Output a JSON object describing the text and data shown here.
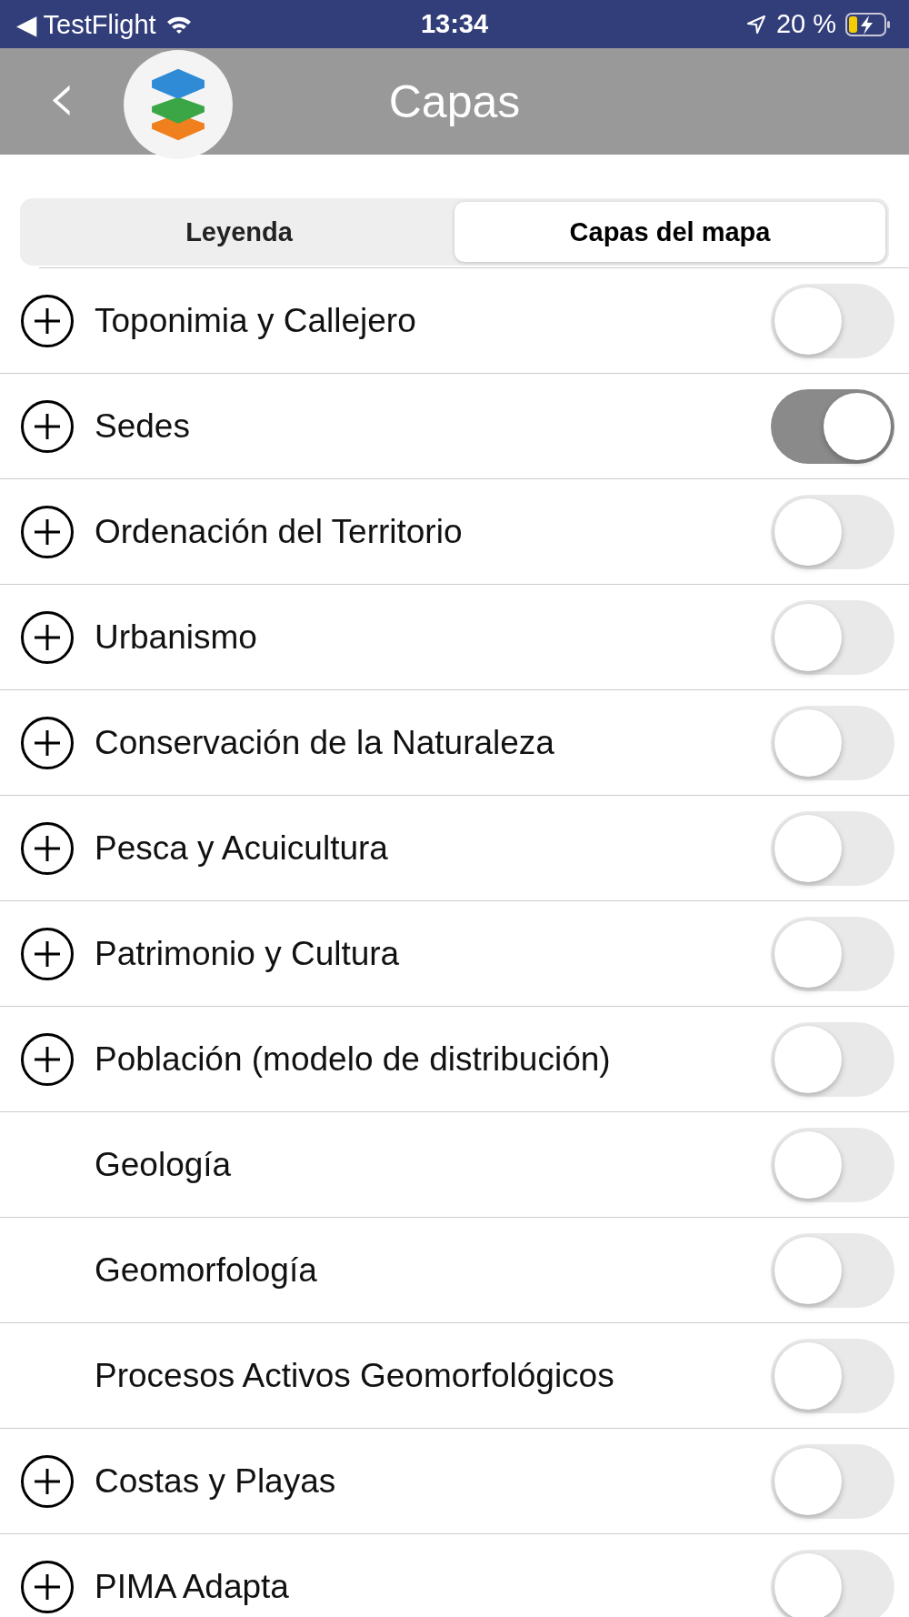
{
  "status_bar": {
    "back_app": "◀ TestFlight",
    "time": "13:34",
    "battery": "20 %"
  },
  "header": {
    "back": "‹",
    "title": "Capas"
  },
  "tabs": [
    {
      "label": "Leyenda",
      "selected": false
    },
    {
      "label": "Capas del mapa",
      "selected": true
    }
  ],
  "layers": [
    {
      "name": "Toponimia y Callejero",
      "expandable": true,
      "on": false
    },
    {
      "name": "Sedes",
      "expandable": true,
      "on": true
    },
    {
      "name": "Ordenación del Territorio",
      "expandable": true,
      "on": false
    },
    {
      "name": "Urbanismo",
      "expandable": true,
      "on": false
    },
    {
      "name": "Conservación de la Naturaleza",
      "expandable": true,
      "on": false
    },
    {
      "name": "Pesca y Acuicultura",
      "expandable": true,
      "on": false
    },
    {
      "name": "Patrimonio y Cultura",
      "expandable": true,
      "on": false
    },
    {
      "name": "Población (modelo de distribución)",
      "expandable": true,
      "on": false
    },
    {
      "name": "Geología",
      "expandable": false,
      "on": false
    },
    {
      "name": "Geomorfología",
      "expandable": false,
      "on": false
    },
    {
      "name": "Procesos Activos Geomorfológicos",
      "expandable": false,
      "on": false
    },
    {
      "name": "Costas y Playas",
      "expandable": true,
      "on": false
    },
    {
      "name": "PIMA Adapta",
      "expandable": true,
      "on": false
    }
  ]
}
